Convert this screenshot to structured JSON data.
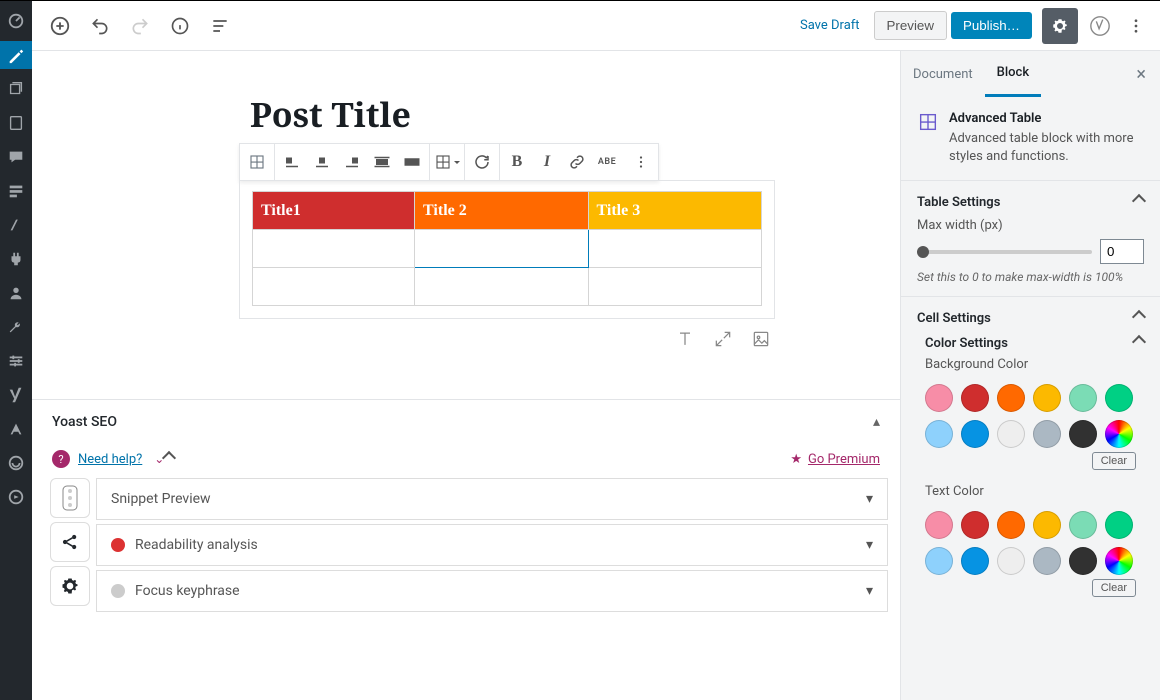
{
  "topbar": {
    "save_draft": "Save Draft",
    "preview": "Preview",
    "publish": "Publish…"
  },
  "post": {
    "title": "Post Title"
  },
  "table": {
    "headers": [
      "Title1",
      "Title 2",
      "Title 3"
    ],
    "header_colors": [
      "#cf2e2e",
      "#ff6900",
      "#fcb900"
    ]
  },
  "yoast": {
    "title": "Yoast SEO",
    "need_help": "Need help?",
    "go_premium": "Go Premium",
    "snippet_preview": "Snippet Preview",
    "readability": "Readability analysis",
    "focus_keyphrase": "Focus keyphrase"
  },
  "sidebar": {
    "tabs": {
      "document": "Document",
      "block": "Block"
    },
    "block_info": {
      "title": "Advanced Table",
      "desc": "Advanced table block with more styles and functions."
    },
    "table_settings": {
      "title": "Table Settings",
      "max_width_label": "Max width (px)",
      "max_width_value": "0",
      "hint": "Set this to 0 to make max-width is 100%"
    },
    "cell_settings": {
      "title": "Cell Settings"
    },
    "color_settings": {
      "title": "Color Settings",
      "bg_label": "Background Color",
      "text_label": "Text Color",
      "clear": "Clear"
    },
    "colors": [
      "#f78da7",
      "#cf2e2e",
      "#ff6900",
      "#fcb900",
      "#7bdcb5",
      "#00d084",
      "#8ed1fc",
      "#0693e3",
      "#eeeeee",
      "#abb8c3",
      "#313131"
    ]
  }
}
